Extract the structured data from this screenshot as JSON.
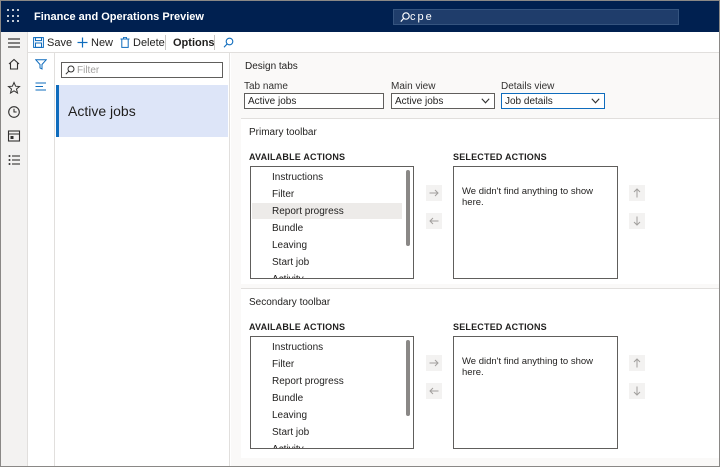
{
  "app": {
    "title": "Finance and Operations Preview"
  },
  "search": {
    "value": "cpe"
  },
  "toolbar": {
    "save_label": "Save",
    "new_label": "New",
    "delete_label": "Delete",
    "options_label": "Options"
  },
  "list": {
    "filter_placeholder": "Filter",
    "items": [
      {
        "label": "Active jobs"
      }
    ]
  },
  "design": {
    "heading": "Design tabs",
    "tab_name_label": "Tab name",
    "tab_name_value": "Active jobs",
    "main_view_label": "Main view",
    "main_view_value": "Active jobs",
    "details_view_label": "Details view",
    "details_view_value": "Job details"
  },
  "primary_toolbar": {
    "title": "Primary toolbar",
    "available_header": "AVAILABLE ACTIONS",
    "selected_header": "SELECTED ACTIONS",
    "available_actions": [
      "Instructions",
      "Filter",
      "Report progress",
      "Bundle",
      "Leaving",
      "Start job",
      "Activity"
    ],
    "highlighted_index": 2,
    "selected_empty_text": "We didn't find anything to show here."
  },
  "secondary_toolbar": {
    "title": "Secondary toolbar",
    "available_header": "AVAILABLE ACTIONS",
    "selected_header": "SELECTED ACTIONS",
    "available_actions": [
      "Instructions",
      "Filter",
      "Report progress",
      "Bundle",
      "Leaving",
      "Start job",
      "Activity"
    ],
    "selected_empty_text": "We didn't find anything to show here."
  },
  "colors": {
    "topbar": "#002050",
    "accent": "#0f6cbd",
    "selected_item": "#dde5f8"
  },
  "icons": [
    "waffle-icon",
    "search-icon",
    "hamburger-icon",
    "home-icon",
    "star-icon",
    "clock-icon",
    "workspace-icon",
    "list-icon",
    "save-icon",
    "plus-icon",
    "trash-icon",
    "filter-icon",
    "arrow-right-icon",
    "arrow-left-icon",
    "arrow-up-icon",
    "arrow-down-icon",
    "chevron-down-icon"
  ]
}
